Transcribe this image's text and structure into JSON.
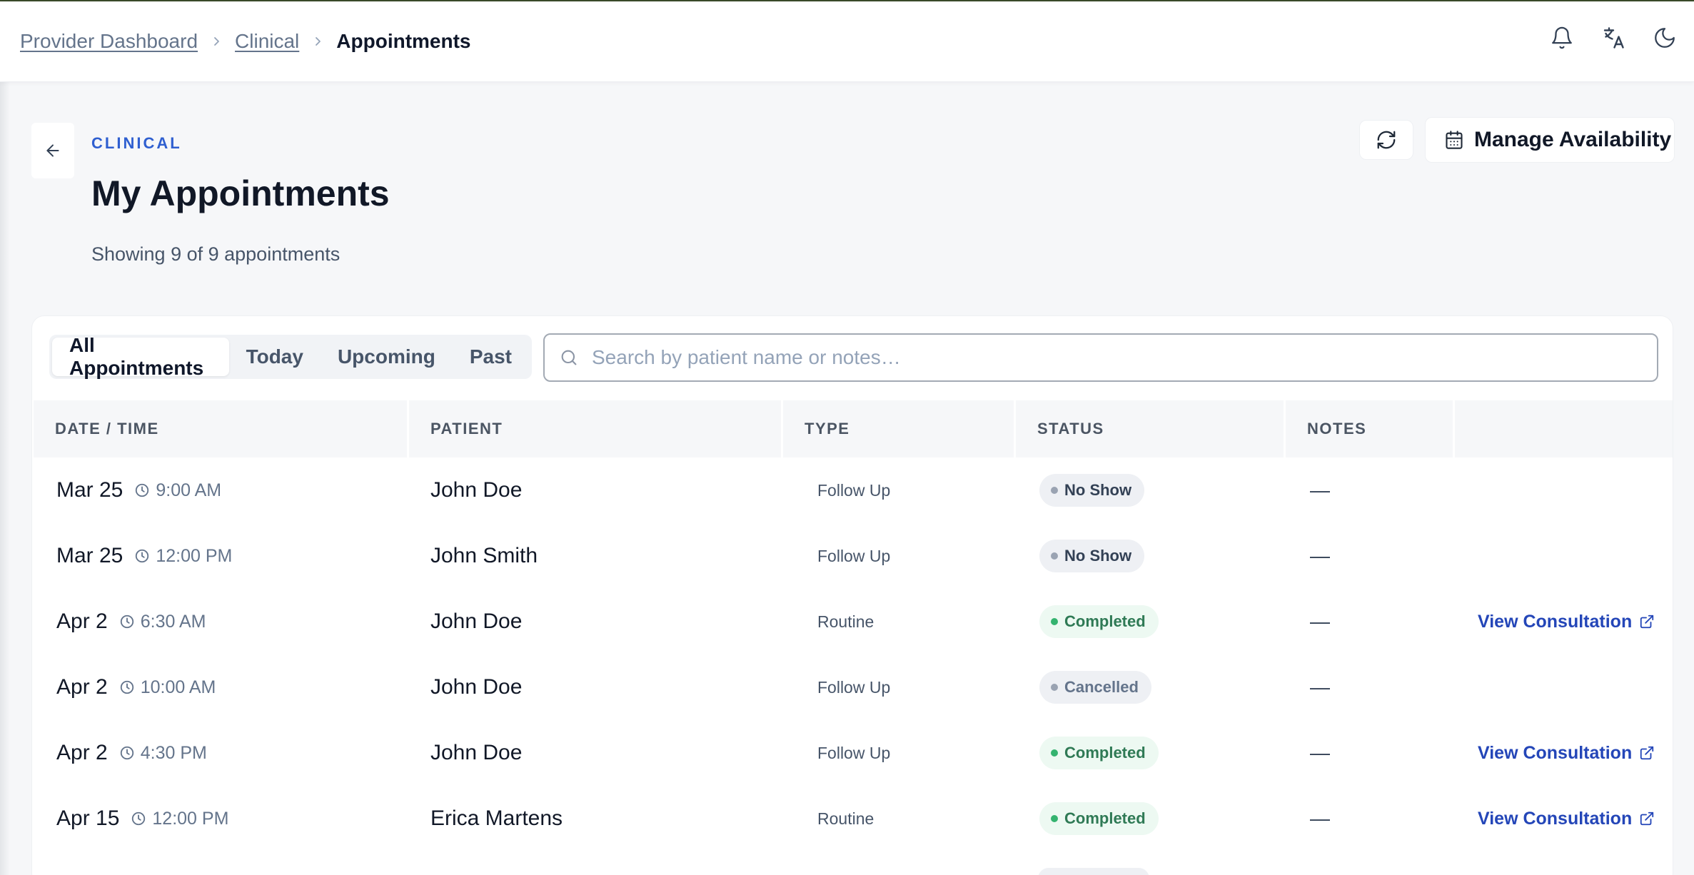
{
  "breadcrumb": {
    "items": [
      "Provider Dashboard",
      "Clinical"
    ],
    "current": "Appointments"
  },
  "top_icons": [
    "bell-icon",
    "translate-icon",
    "moon-icon"
  ],
  "header": {
    "eyebrow": "CLINICAL",
    "title": "My Appointments",
    "subtitle": "Showing 9 of 9 appointments",
    "manage_label": "Manage Availability"
  },
  "tabs": [
    {
      "label": "All Appointments",
      "active": true
    },
    {
      "label": "Today",
      "active": false
    },
    {
      "label": "Upcoming",
      "active": false
    },
    {
      "label": "Past",
      "active": false
    }
  ],
  "search": {
    "placeholder": "Search by patient name or notes…",
    "value": ""
  },
  "table": {
    "columns": [
      "DATE / TIME",
      "PATIENT",
      "TYPE",
      "STATUS",
      "NOTES",
      ""
    ],
    "rows": [
      {
        "date": "Mar 25",
        "time": "9:00 AM",
        "patient": "John Doe",
        "type": "Follow Up",
        "status": "No Show",
        "notes": "—",
        "action": ""
      },
      {
        "date": "Mar 25",
        "time": "12:00 PM",
        "patient": "John Smith",
        "type": "Follow Up",
        "status": "No Show",
        "notes": "—",
        "action": ""
      },
      {
        "date": "Apr 2",
        "time": "6:30 AM",
        "patient": "John Doe",
        "type": "Routine",
        "status": "Completed",
        "notes": "—",
        "action": "View Consultation"
      },
      {
        "date": "Apr 2",
        "time": "10:00 AM",
        "patient": "John Doe",
        "type": "Follow Up",
        "status": "Cancelled",
        "notes": "—",
        "action": ""
      },
      {
        "date": "Apr 2",
        "time": "4:30 PM",
        "patient": "John Doe",
        "type": "Follow Up",
        "status": "Completed",
        "notes": "—",
        "action": "View Consultation"
      },
      {
        "date": "Apr 15",
        "time": "12:00 PM",
        "patient": "Erica Martens",
        "type": "Routine",
        "status": "Completed",
        "notes": "—",
        "action": "View Consultation"
      }
    ]
  },
  "colors": {
    "accent": "#2f5fd0",
    "link": "#2446b8",
    "completed": "#34b36f",
    "neutral": "#9aa3b2"
  }
}
